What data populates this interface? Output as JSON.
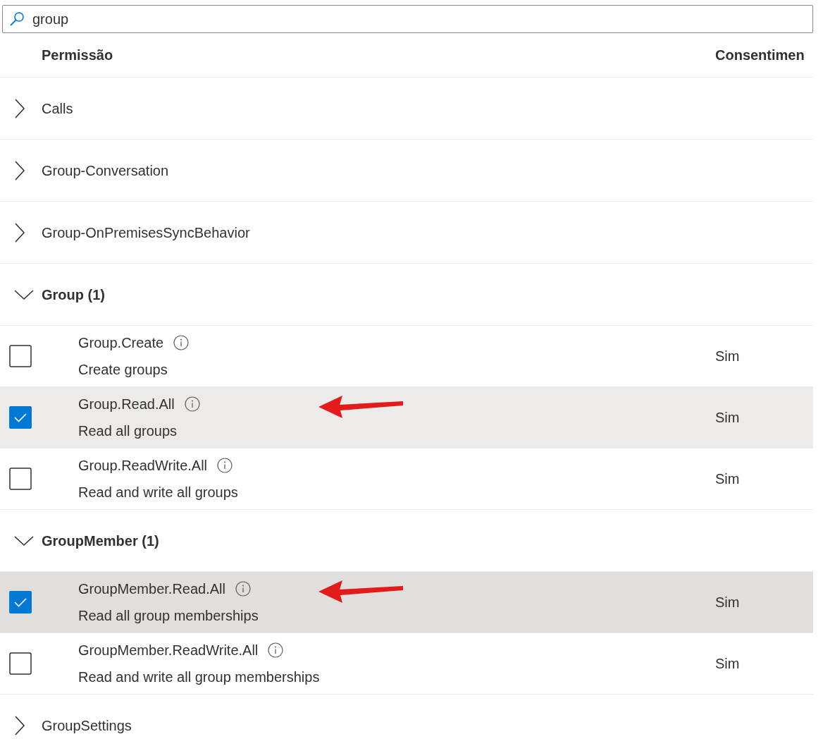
{
  "search": {
    "value": "group"
  },
  "columns": [
    "Permissão",
    "Consentimen"
  ],
  "groups": [
    {
      "label": "Calls",
      "expanded": false
    },
    {
      "label": "Group-Conversation",
      "expanded": false
    },
    {
      "label": "Group-OnPremisesSyncBehavior",
      "expanded": false
    },
    {
      "label": "Group (1)",
      "expanded": true,
      "permissions": [
        {
          "name": "Group.Create",
          "description": "Create groups",
          "consent": "Sim",
          "selected": false,
          "hovered": false,
          "arrow": false
        },
        {
          "name": "Group.Read.All",
          "description": "Read all groups",
          "consent": "Sim",
          "selected": true,
          "hovered": false,
          "arrow": true
        },
        {
          "name": "Group.ReadWrite.All",
          "description": "Read and write all groups",
          "consent": "Sim",
          "selected": false,
          "hovered": false,
          "arrow": false
        }
      ]
    },
    {
      "label": "GroupMember (1)",
      "expanded": true,
      "permissions": [
        {
          "name": "GroupMember.Read.All",
          "description": "Read all group memberships",
          "consent": "Sim",
          "selected": true,
          "hovered": true,
          "arrow": true
        },
        {
          "name": "GroupMember.ReadWrite.All",
          "description": "Read and write all group memberships",
          "consent": "Sim",
          "selected": false,
          "hovered": false,
          "arrow": false
        }
      ]
    },
    {
      "label": "GroupSettings",
      "expanded": false
    }
  ]
}
